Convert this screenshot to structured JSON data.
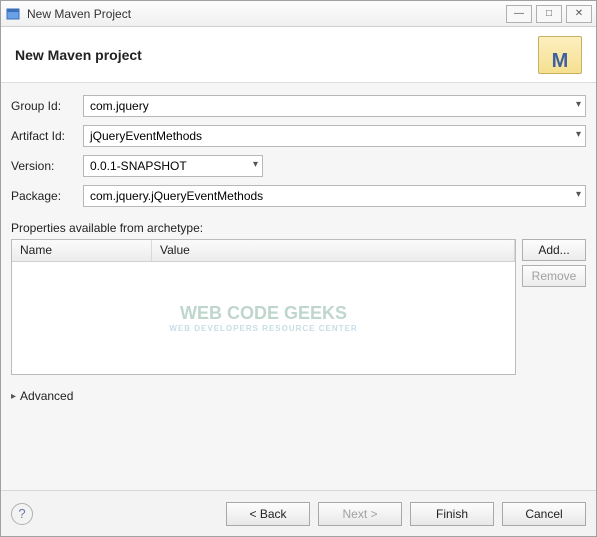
{
  "window": {
    "title": "New Maven Project",
    "min": "—",
    "max": "□",
    "close": "✕"
  },
  "banner": {
    "heading": "New Maven project",
    "logo_letter": "M"
  },
  "form": {
    "group_id_label": "Group Id:",
    "group_id_value": "com.jquery",
    "artifact_id_label": "Artifact Id:",
    "artifact_id_value": "jQueryEventMethods",
    "version_label": "Version:",
    "version_value": "0.0.1-SNAPSHOT",
    "package_label": "Package:",
    "package_value": "com.jquery.jQueryEventMethods"
  },
  "properties": {
    "section_label": "Properties available from archetype:",
    "col_name": "Name",
    "col_value": "Value",
    "add_label": "Add...",
    "remove_label": "Remove"
  },
  "advanced": {
    "label": "Advanced",
    "chevron": "▸"
  },
  "footer": {
    "help": "?",
    "back": "< Back",
    "next": "Next >",
    "finish": "Finish",
    "cancel": "Cancel"
  },
  "watermark": {
    "title": "WEB CODE GEEKS",
    "subtitle": "WEB DEVELOPERS RESOURCE CENTER"
  }
}
